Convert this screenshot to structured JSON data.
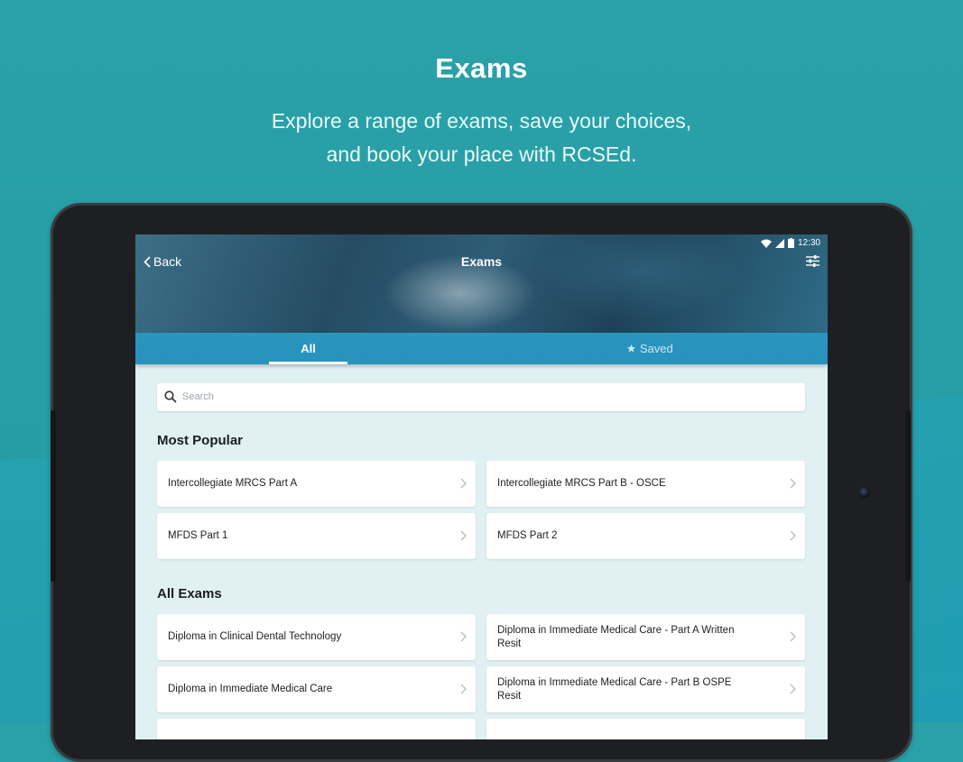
{
  "promo": {
    "title": "Exams",
    "subtitle_line1": "Explore a range of exams, save your choices,",
    "subtitle_line2": "and book your place with RCSEd."
  },
  "status_bar": {
    "time": "12:30"
  },
  "navbar": {
    "back_label": "Back",
    "title": "Exams"
  },
  "tabs": [
    {
      "label": "All",
      "active": true
    },
    {
      "label": "Saved",
      "icon": "star-icon",
      "active": false
    }
  ],
  "search": {
    "placeholder": "Search"
  },
  "most_popular": {
    "title": "Most Popular",
    "items": [
      {
        "label": "Intercollegiate MRCS Part A"
      },
      {
        "label": "Intercollegiate MRCS Part B - OSCE"
      },
      {
        "label": "MFDS Part 1"
      },
      {
        "label": "MFDS Part 2"
      }
    ]
  },
  "all_exams": {
    "title": "All Exams",
    "items": [
      {
        "label": "Diploma in Clinical Dental Technology"
      },
      {
        "label": "Diploma in Immediate Medical Care - Part A Written Resit"
      },
      {
        "label": "Diploma in Immediate Medical Care"
      },
      {
        "label": "Diploma in Immediate Medical Care - Part B OSPE Resit"
      }
    ]
  },
  "colors": {
    "accent": "#2a96bf",
    "background": "#2aa1a8",
    "list_background": "#e0f0f3"
  }
}
